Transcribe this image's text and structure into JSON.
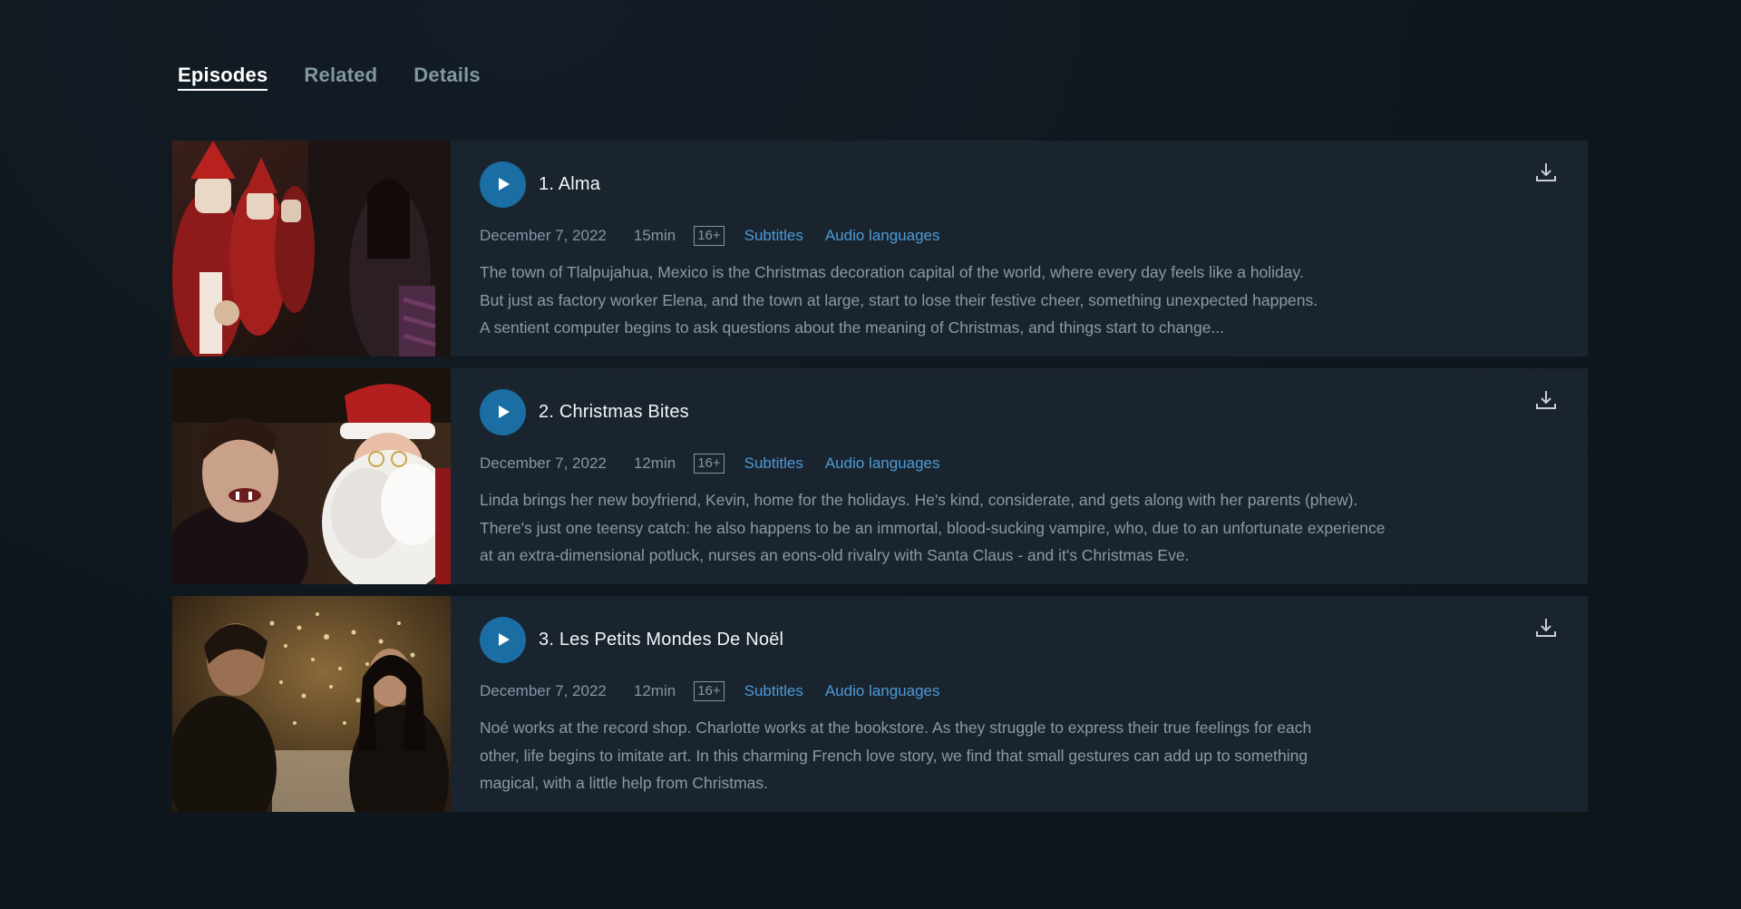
{
  "tabs": [
    {
      "label": "Episodes",
      "active": true
    },
    {
      "label": "Related",
      "active": false
    },
    {
      "label": "Details",
      "active": false
    }
  ],
  "colors": {
    "background": "#0f171e",
    "card": "#1a242f",
    "play_button": "#1a6ea3",
    "link": "#4b9ad6",
    "muted_text": "#8197a4"
  },
  "episodes": [
    {
      "title": "1. Alma",
      "date": "December 7, 2022",
      "duration": "15min",
      "rating": "16+",
      "subtitles_label": "Subtitles",
      "audio_label": "Audio languages",
      "description": [
        "The town of Tlalpujahua, Mexico is the Christmas decoration capital of the world, where every day feels like a holiday.",
        "But just as factory worker Elena, and the town at large, start to lose their festive cheer, something unexpected happens.",
        "A sentient computer begins to ask questions about the meaning of Christmas, and things start to change..."
      ],
      "icons": {
        "play": "play-icon",
        "download": "download-icon"
      }
    },
    {
      "title": "2. Christmas Bites",
      "date": "December 7, 2022",
      "duration": "12min",
      "rating": "16+",
      "subtitles_label": "Subtitles",
      "audio_label": "Audio languages",
      "description": [
        "Linda brings her new boyfriend, Kevin, home for the holidays. He's kind, considerate, and gets along with her parents (phew).",
        "There's just one teensy catch: he also happens to be an immortal, blood-sucking vampire, who, due to an unfortunate experience",
        "at an extra-dimensional potluck, nurses an eons-old rivalry with Santa Claus - and it's Christmas Eve."
      ],
      "icons": {
        "play": "play-icon",
        "download": "download-icon"
      }
    },
    {
      "title": "3. Les Petits Mondes De Noël",
      "date": "December 7, 2022",
      "duration": "12min",
      "rating": "16+",
      "subtitles_label": "Subtitles",
      "audio_label": "Audio languages",
      "description": [
        "Noé works at the record shop. Charlotte works at the bookstore. As they struggle to express their true feelings for each",
        "other, life begins to imitate art. In this charming French love story, we find that small gestures can add up to something",
        "magical, with a little help from Christmas."
      ],
      "icons": {
        "play": "play-icon",
        "download": "download-icon"
      }
    }
  ]
}
